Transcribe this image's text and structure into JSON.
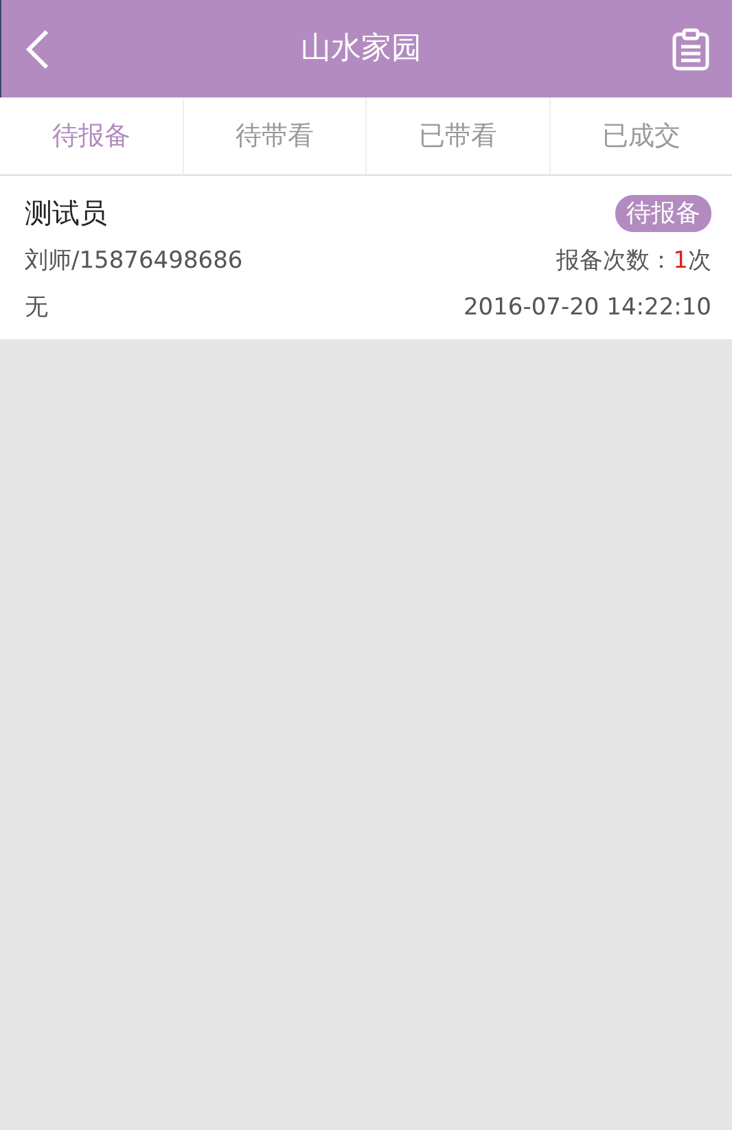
{
  "header": {
    "title": "山水家园"
  },
  "tabs": [
    {
      "label": "待报备",
      "selected": true
    },
    {
      "label": "待带看",
      "selected": false
    },
    {
      "label": "已带看",
      "selected": false
    },
    {
      "label": "已成交",
      "selected": false
    }
  ],
  "records": [
    {
      "name": "测试员",
      "status": "待报备",
      "contact": "刘师/15876498686",
      "count_label": "报备次数：",
      "count": "1",
      "count_unit": "次",
      "note": "无",
      "time": "2016-07-20 14:22:10"
    }
  ]
}
